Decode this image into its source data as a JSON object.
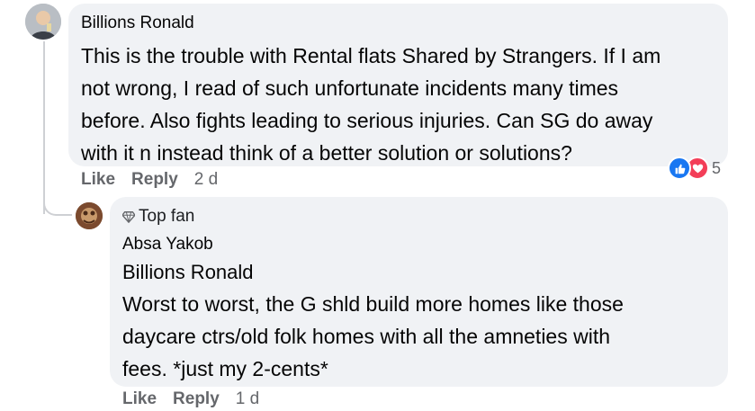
{
  "comments": [
    {
      "author": "Billions Ronald",
      "text": "This is the trouble with Rental flats Shared by Strangers. If I am\nnot wrong, I read of such unfortunate incidents many times\nbefore. Also fights leading to serious injuries. Can SG do away\nwith it n instead think of a better solution or solutions?",
      "actions": {
        "like": "Like",
        "reply": "Reply",
        "time": "2 d"
      },
      "reaction_count": "5",
      "reaction_icons": [
        "like-icon",
        "love-icon"
      ]
    },
    {
      "badge": "Top fan",
      "badge_icon": "diamond-icon",
      "author": "Absa Yakob",
      "mention": "Billions Ronald",
      "text": "Worst to worst, the G shld build more homes like those\ndaycare ctrs/old folk homes with all the amneties with\nfees. *just my 2-cents*",
      "actions": {
        "like": "Like",
        "reply": "Reply",
        "time": "1 d"
      }
    }
  ],
  "colors": {
    "bubble": "#f0f2f5",
    "secondary_text": "#65676b",
    "like_blue": "#1877f2",
    "love_red": "#f33e58"
  }
}
